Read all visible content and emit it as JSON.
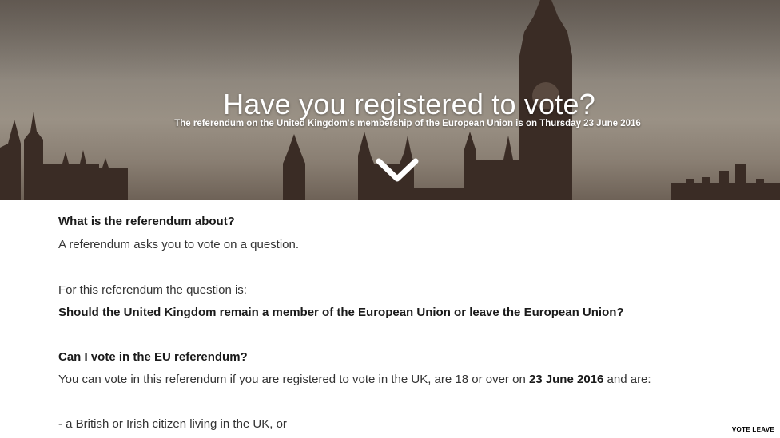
{
  "hero": {
    "title": "Have you registered to vote?",
    "subtitle": "The referendum on the United Kingdom's membership of the European Union is on Thursday 23 June 2016",
    "scroll_icon": "chevron-down-icon"
  },
  "content": {
    "about_heading": "What is the referendum about?",
    "about_text": "A referendum asks you to vote on a question.",
    "question_intro": "For this referendum the question is:",
    "question": "Should the United Kingdom remain a member of the European Union or leave the European Union?",
    "eligibility_heading": "Can I vote in the EU referendum?",
    "eligibility_text_before": "You can vote in this referendum if you are registered to vote in the UK, are 18 or over on ",
    "eligibility_date": "23 June 2016",
    "eligibility_text_after": " and are:",
    "bullet_1": " - a British or Irish citizen living in the UK, or"
  },
  "watermark": "VOTE LEAVE",
  "colors": {
    "hero_sky": "#8c857c",
    "hero_silhouette": "#3a2c25",
    "body_text": "#333333",
    "heading_text": "#1a1a1a"
  }
}
